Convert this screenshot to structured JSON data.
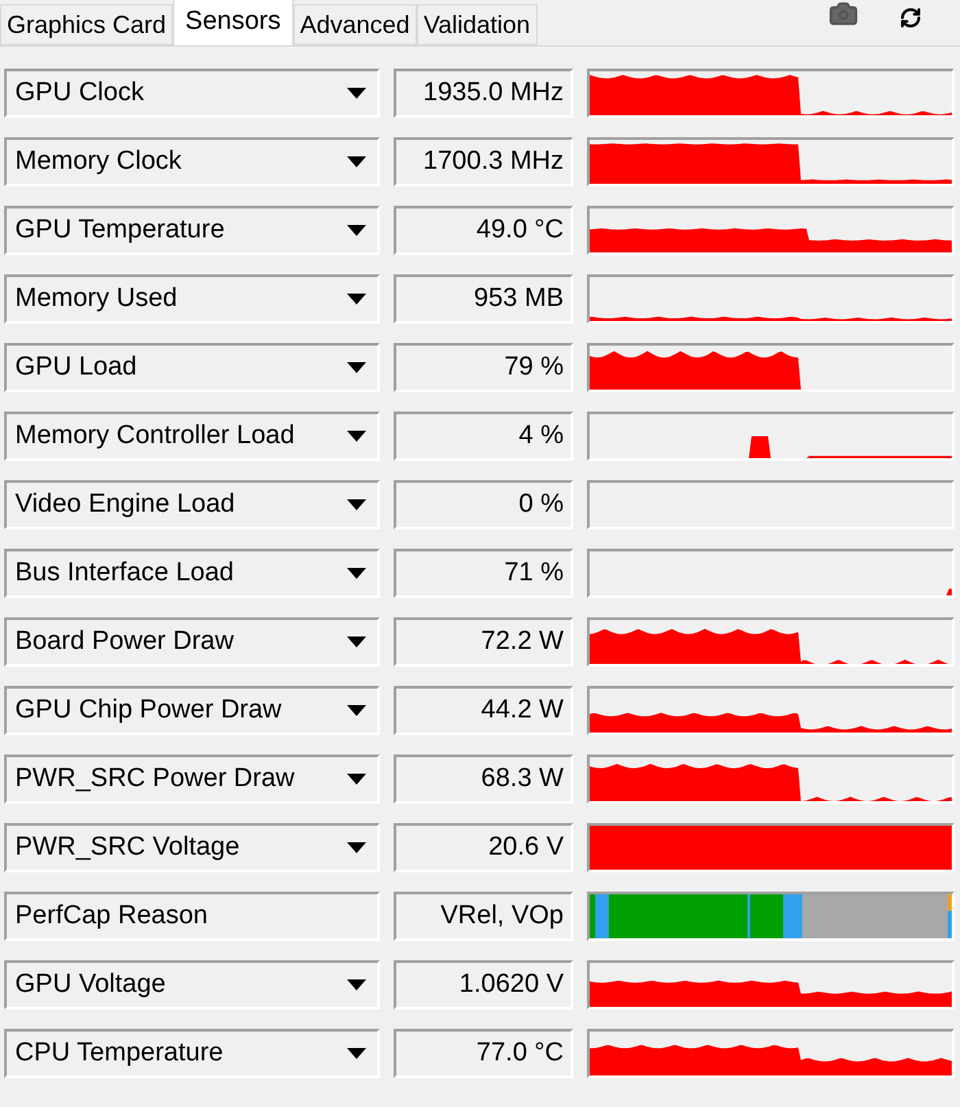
{
  "tabs": [
    {
      "label": "Graphics Card",
      "selected": false
    },
    {
      "label": "Sensors",
      "selected": true
    },
    {
      "label": "Advanced",
      "selected": false
    },
    {
      "label": "Validation",
      "selected": false
    }
  ],
  "sensors": [
    {
      "name": "GPU Clock",
      "value": "1935.0 MHz",
      "kind": "graph"
    },
    {
      "name": "Memory Clock",
      "value": "1700.3 MHz",
      "kind": "graph"
    },
    {
      "name": "GPU Temperature",
      "value": "49.0 °C",
      "kind": "graph"
    },
    {
      "name": "Memory Used",
      "value": "953 MB",
      "kind": "graph"
    },
    {
      "name": "GPU Load",
      "value": "79 %",
      "kind": "graph"
    },
    {
      "name": "Memory Controller Load",
      "value": "4 %",
      "kind": "graph"
    },
    {
      "name": "Video Engine Load",
      "value": "0 %",
      "kind": "graph"
    },
    {
      "name": "Bus Interface Load",
      "value": "71 %",
      "kind": "graph"
    },
    {
      "name": "Board Power Draw",
      "value": "72.2 W",
      "kind": "graph"
    },
    {
      "name": "GPU Chip Power Draw",
      "value": "44.2 W",
      "kind": "graph"
    },
    {
      "name": "PWR_SRC Power Draw",
      "value": "68.3 W",
      "kind": "graph"
    },
    {
      "name": "PWR_SRC Voltage",
      "value": "20.6 V",
      "kind": "graph"
    },
    {
      "name": "PerfCap Reason",
      "value": "VRel, VOp",
      "kind": "perfcap"
    },
    {
      "name": "GPU Voltage",
      "value": "1.0620 V",
      "kind": "graph"
    },
    {
      "name": "CPU Temperature",
      "value": "77.0 °C",
      "kind": "graph"
    }
  ]
}
